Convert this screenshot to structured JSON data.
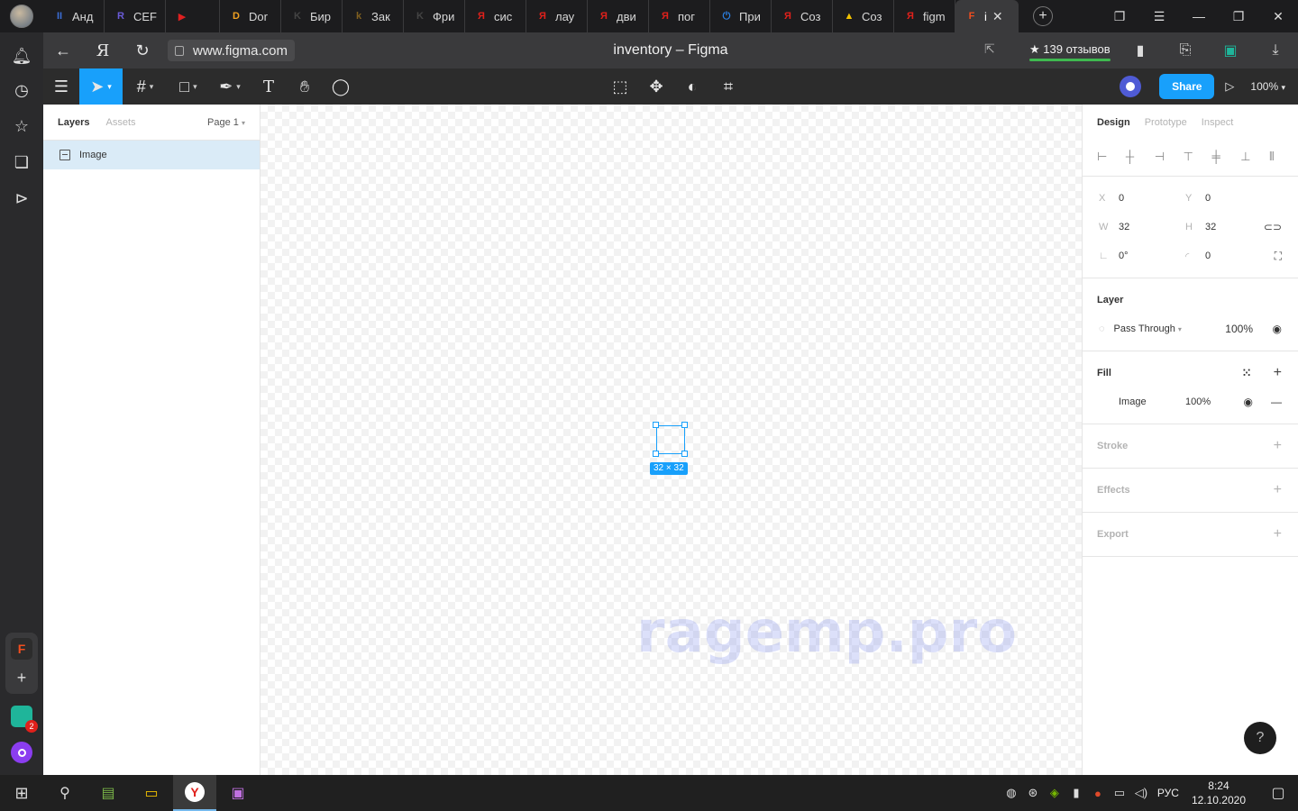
{
  "browser": {
    "tabs": [
      {
        "label": "Анд",
        "fav": "II",
        "color": "#3b6ed8"
      },
      {
        "label": "CEF",
        "fav": "R",
        "color": "#6a5bd8"
      },
      {
        "label": "",
        "fav": "▶",
        "color": "#e02020"
      },
      {
        "label": "Dor",
        "fav": "D",
        "color": "#f0a020"
      },
      {
        "label": "Бир",
        "fav": "K",
        "color": "#444444"
      },
      {
        "label": "Зак",
        "fav": "k",
        "color": "#806020"
      },
      {
        "label": "Фри",
        "fav": "K",
        "color": "#444444"
      },
      {
        "label": "сис",
        "fav": "Я",
        "color": "#e0201b"
      },
      {
        "label": "лау",
        "fav": "Я",
        "color": "#e0201b"
      },
      {
        "label": "дви",
        "fav": "Я",
        "color": "#e0201b"
      },
      {
        "label": "пог",
        "fav": "Я",
        "color": "#e0201b"
      },
      {
        "label": "При",
        "fav": "⏻",
        "color": "#2b7fe0"
      },
      {
        "label": "Соз",
        "fav": "Я",
        "color": "#e0201b"
      },
      {
        "label": "Соз",
        "fav": "▲",
        "color": "#f2c200"
      },
      {
        "label": "figm",
        "fav": "Я",
        "color": "#e0201b"
      },
      {
        "label": "i",
        "fav": "F",
        "color": "#f24e1e",
        "active": true
      }
    ],
    "url": "www.figma.com",
    "page_title": "inventory – Figma",
    "reviews": "★ 139 отзывов"
  },
  "figma": {
    "share_label": "Share",
    "zoom": "100%",
    "layers_tab": "Layers",
    "assets_tab": "Assets",
    "page_selector": "Page 1",
    "layers": [
      {
        "name": "Image"
      }
    ],
    "canvas": {
      "selection_label": "32 × 32"
    },
    "right_tabs": {
      "design": "Design",
      "prototype": "Prototype",
      "inspect": "Inspect"
    },
    "geometry": {
      "x_label": "X",
      "x": "0",
      "y_label": "Y",
      "y": "0",
      "w_label": "W",
      "w": "32",
      "h_label": "H",
      "h": "32",
      "rotation": "0°",
      "radius": "0"
    },
    "layer_section": {
      "title": "Layer",
      "blend": "Pass Through",
      "opacity": "100%"
    },
    "fill_section": {
      "title": "Fill",
      "type": "Image",
      "opacity": "100%"
    },
    "stroke_title": "Stroke",
    "effects_title": "Effects",
    "export_title": "Export"
  },
  "watermark": "ragemp.pro",
  "taskbar": {
    "lang": "РУС",
    "time": "8:24",
    "date": "12.10.2020",
    "badge": "2"
  }
}
